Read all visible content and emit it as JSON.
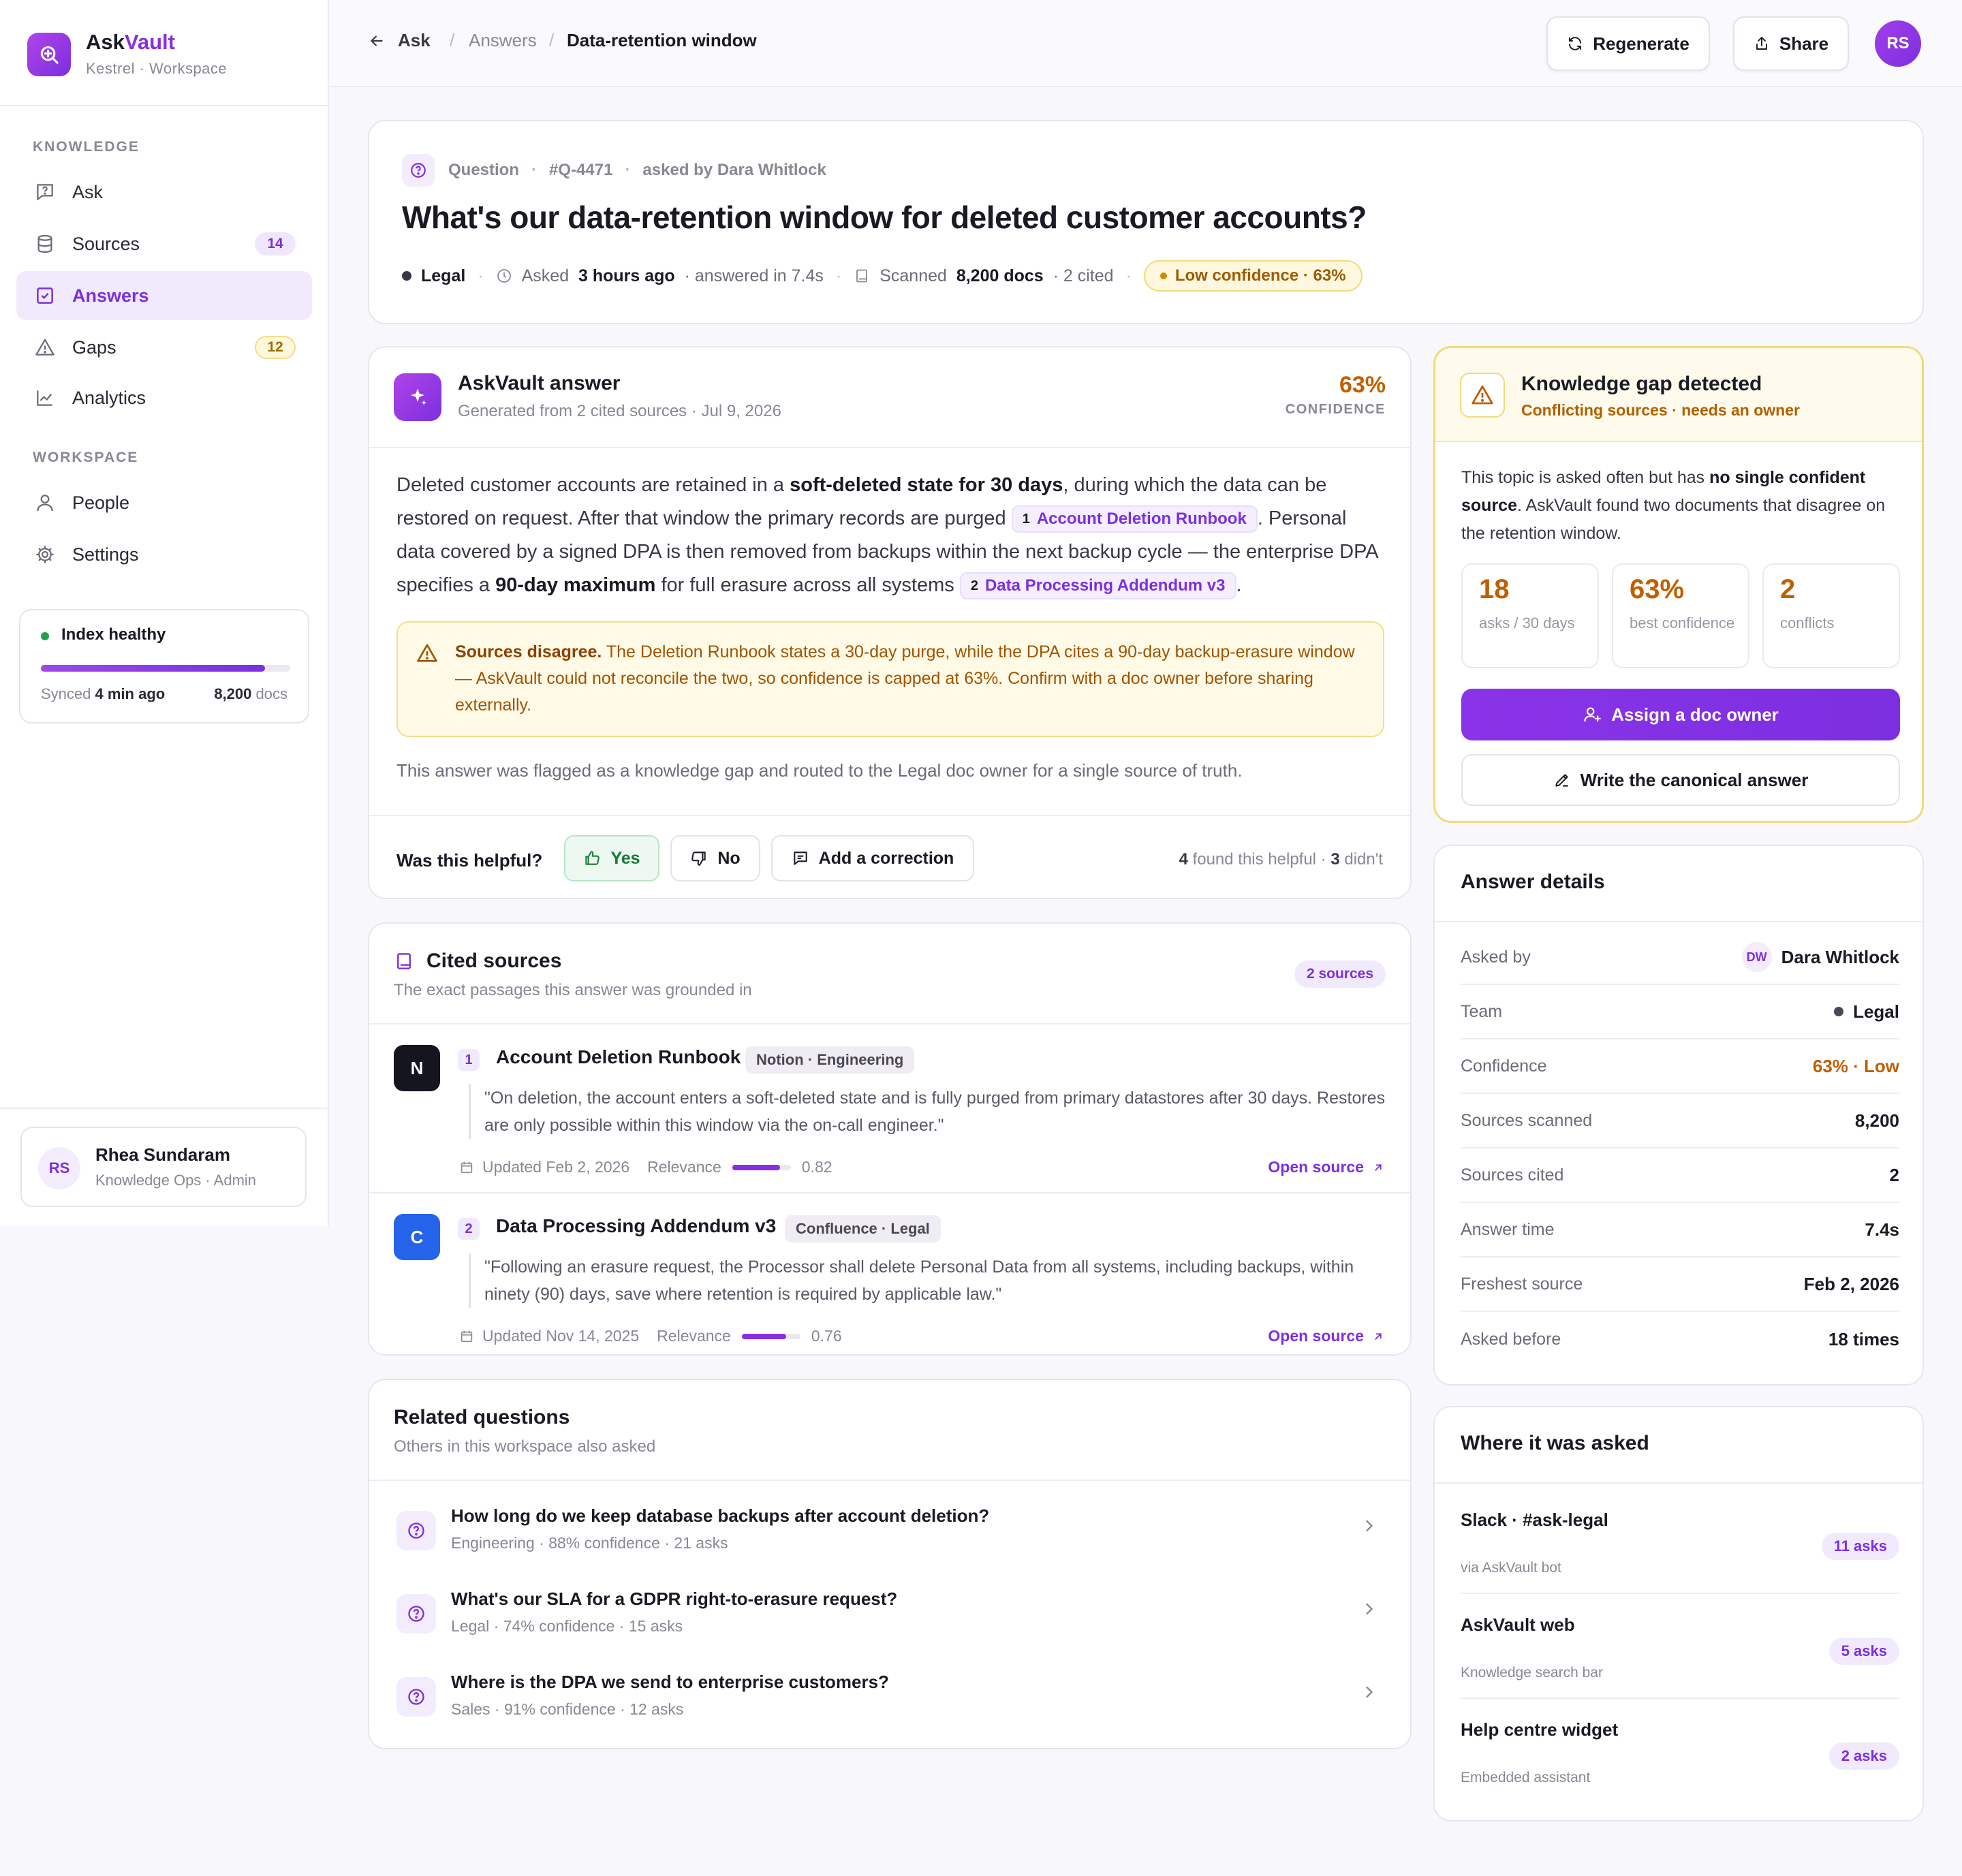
{
  "brand": {
    "name_prefix": "Ask",
    "name_accent": "Vault",
    "subtitle": "Kestrel · Workspace"
  },
  "sidebar": {
    "sections": {
      "knowledge": "KNOWLEDGE",
      "workspace": "WORKSPACE"
    },
    "items": [
      {
        "label": "Ask",
        "icon": "chat-question-icon"
      },
      {
        "label": "Sources",
        "icon": "database-icon",
        "badge": "14"
      },
      {
        "label": "Answers",
        "icon": "check-square-icon",
        "active": true
      },
      {
        "label": "Gaps",
        "icon": "warning-triangle-icon",
        "badge": "12"
      },
      {
        "label": "Analytics",
        "icon": "line-chart-icon"
      },
      {
        "label": "People",
        "icon": "person-icon"
      },
      {
        "label": "Settings",
        "icon": "gear-icon"
      }
    ],
    "index": {
      "title": "Index healthy",
      "progress": 0.9,
      "synced_prefix": "Synced",
      "synced_value": "4 min ago",
      "docs_value": "8,200",
      "docs_label": "docs"
    },
    "user": {
      "initials": "RS",
      "name": "Rhea Sundaram",
      "role": "Knowledge Ops · Admin"
    }
  },
  "topbar": {
    "back_label": "Ask",
    "crumb_parent": "Answers",
    "crumb_current": "Data-retention window",
    "regenerate_label": "Regenerate",
    "share_label": "Share",
    "avatar_initials": "RS"
  },
  "question": {
    "kind": "Question",
    "id": "#Q-4471",
    "asked_by": "asked by Dara Whitlock",
    "title": "What's our data-retention window for deleted customer accounts?",
    "team": "Legal",
    "asked_label": "Asked",
    "asked_value": "3 hours ago",
    "answered": "· answered in 7.4s",
    "scanned_label": "Scanned",
    "scanned_value": "8,200 docs",
    "cited": "· 2 cited",
    "confidence_chip": "Low confidence · 63%"
  },
  "answer": {
    "title": "AskVault answer",
    "subtitle": "Generated from 2 cited sources · Jul 9, 2026",
    "confidence_value": "63%",
    "confidence_label": "CONFIDENCE",
    "body": {
      "p1": "Deleted customer accounts are retained in a ",
      "b1": "soft-deleted state for 30 days",
      "p2": ", during which the data can be restored on request. After that window the primary records are purged ",
      "cite1_num": "1",
      "cite1_label": "Account Deletion Runbook",
      "p3": ". Personal data covered by a signed DPA is then removed from backups within the next backup cycle — the enterprise DPA specifies a ",
      "b2": "90-day maximum",
      "p4": " for full erasure across all systems ",
      "cite2_num": "2",
      "cite2_label": "Data Processing Addendum v3",
      "p5": "."
    },
    "warning_strong": "Sources disagree.",
    "warning_text": " The Deletion Runbook states a 30-day purge, while the DPA cites a 90-day backup-erasure window — AskVault could not reconcile the two, so confidence is capped at 63%. Confirm with a doc owner before sharing externally.",
    "note": "This answer was flagged as a knowledge gap and routed to the Legal doc owner for a single source of truth.",
    "helpful_question": "Was this helpful?",
    "yes_label": "Yes",
    "no_label": "No",
    "correction_label": "Add a correction",
    "helpful_count": "4",
    "helpful_text": "found this helpful ·",
    "unhelpful_count": "3",
    "unhelpful_text": "didn't"
  },
  "cited_sources": {
    "title": "Cited sources",
    "subtitle": "The exact passages this answer was grounded in",
    "count_label": "2 sources",
    "open_label": "Open source",
    "relevance_label": "Relevance",
    "items": [
      {
        "logo": "N",
        "logo_color": "#14151f",
        "num": "1",
        "title": "Account Deletion Runbook",
        "tag": "Notion · Engineering",
        "quote": "\"On deletion, the account enters a soft-deleted state and is fully purged from primary datastores after 30 days. Restores are only possible within this window via the on-call engineer.\"",
        "updated": "Updated Feb 2, 2026",
        "relevance": "0.82"
      },
      {
        "logo": "C",
        "logo_color": "#2563eb",
        "num": "2",
        "title": "Data Processing Addendum v3",
        "tag": "Confluence · Legal",
        "quote": "\"Following an erasure request, the Processor shall delete Personal Data from all systems, including backups, within ninety (90) days, save where retention is required by applicable law.\"",
        "updated": "Updated Nov 14, 2025",
        "relevance": "0.76"
      }
    ]
  },
  "related": {
    "title": "Related questions",
    "subtitle": "Others in this workspace also asked",
    "items": [
      {
        "q": "How long do we keep database backups after account deletion?",
        "meta": "Engineering · 88% confidence · 21 asks"
      },
      {
        "q": "What's our SLA for a GDPR right-to-erasure request?",
        "meta": "Legal · 74% confidence · 15 asks"
      },
      {
        "q": "Where is the DPA we send to enterprise customers?",
        "meta": "Sales · 91% confidence · 12 asks"
      }
    ]
  },
  "gap": {
    "title": "Knowledge gap detected",
    "subtitle": "Conflicting sources · needs an owner",
    "text_p1": "This topic is asked often but has ",
    "text_b1": "no single confident source",
    "text_p2": ". AskVault found two documents that disagree on the retention window.",
    "stats": [
      {
        "value": "18",
        "label": "asks / 30 days"
      },
      {
        "value": "63%",
        "label": "best confidence"
      },
      {
        "value": "2",
        "label": "conflicts"
      }
    ],
    "assign_label": "Assign a doc owner",
    "write_label": "Write the canonical answer"
  },
  "details": {
    "title": "Answer details",
    "rows": [
      {
        "k": "Asked by",
        "v": "Dara Whitlock",
        "avatar": "DW"
      },
      {
        "k": "Team",
        "v": "Legal"
      },
      {
        "k": "Confidence",
        "v": "63% · Low"
      },
      {
        "k": "Sources scanned",
        "v": "8,200"
      },
      {
        "k": "Sources cited",
        "v": "2"
      },
      {
        "k": "Answer time",
        "v": "7.4s"
      },
      {
        "k": "Freshest source",
        "v": "Feb 2, 2026"
      },
      {
        "k": "Asked before",
        "v": "18 times"
      }
    ]
  },
  "where": {
    "title": "Where it was asked",
    "items": [
      {
        "t": "Slack · #ask-legal",
        "s": "via AskVault bot",
        "c": "11 asks"
      },
      {
        "t": "AskVault web",
        "s": "Knowledge search bar",
        "c": "5 asks"
      },
      {
        "t": "Help centre widget",
        "s": "Embedded assistant",
        "c": "2 asks"
      }
    ]
  },
  "colors": {
    "accent": "#7c2fe0",
    "warning": "#c05f00",
    "success": "#177a38"
  }
}
